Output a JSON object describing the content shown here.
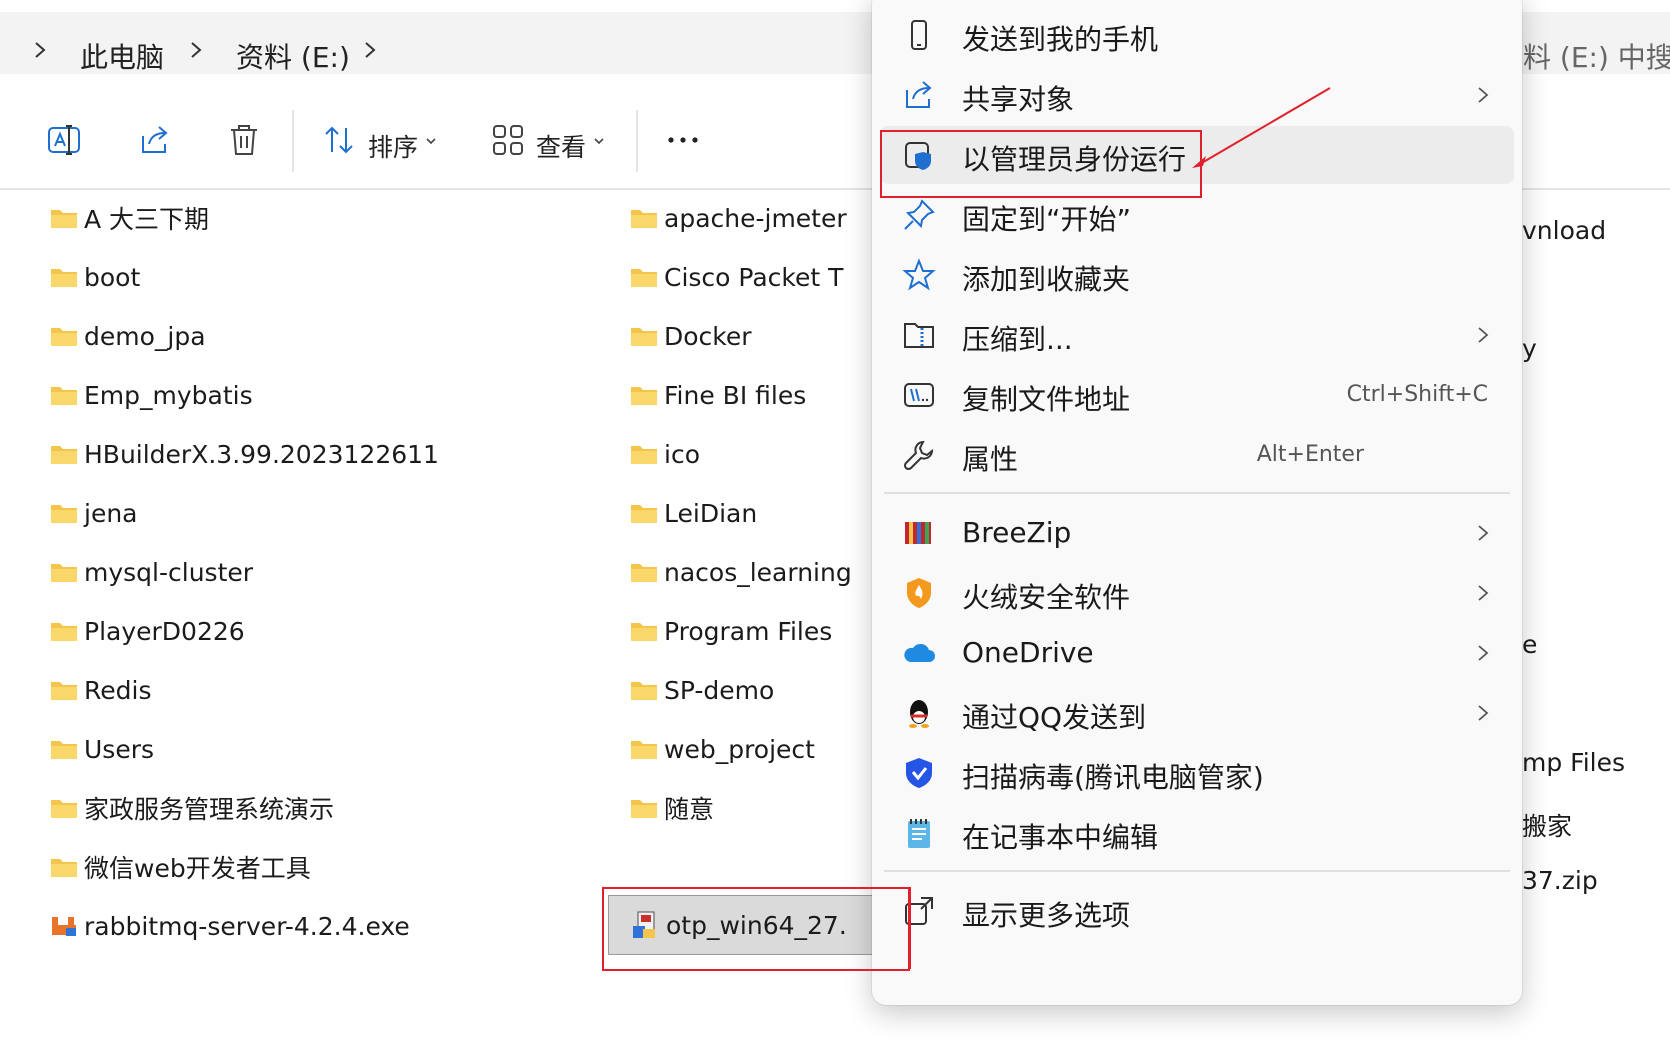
{
  "breadcrumb": {
    "items": [
      "此电脑",
      "资料 (E:)"
    ]
  },
  "search": {
    "ghost_text": "资料 (E:) 中搜"
  },
  "toolbar": {
    "sort_label": "排序",
    "view_label": "查看"
  },
  "files": {
    "col1": [
      "A 大三下期",
      "boot",
      "demo_jpa",
      "Emp_mybatis",
      "HBuilderX.3.99.2023122611",
      "jena",
      "mysql-cluster",
      "PlayerD0226",
      "Redis",
      "Users",
      "家政服务管理系统演示",
      "微信web开发者工具",
      "rabbitmq-server-4.2.4.exe"
    ],
    "col2": [
      "apache-jmeter",
      "Cisco Packet T",
      "Docker",
      "Fine BI files",
      "ico",
      "LeiDian",
      "nacos_learning",
      "Program Files",
      "SP-demo",
      "web_project",
      "随意",
      "otp_win64_27."
    ],
    "col3_partial": [
      "vnload",
      "y",
      "e",
      "mp Files",
      "搬家",
      "37.zip"
    ]
  },
  "menu": {
    "items": [
      {
        "label": "发送到我的手机",
        "icon": "phone-icon"
      },
      {
        "label": "共享对象",
        "icon": "share-icon",
        "submenu": true
      },
      {
        "label": "以管理员身份运行",
        "icon": "shield-icon"
      },
      {
        "label": "固定到“开始”",
        "icon": "pin-icon"
      },
      {
        "label": "添加到收藏夹",
        "icon": "star-icon"
      },
      {
        "label": "压缩到...",
        "icon": "zip-folder-icon",
        "submenu": true
      },
      {
        "label": "复制文件地址",
        "icon": "copy-path-icon",
        "shortcut": "Ctrl+Shift+C"
      },
      {
        "label": "属性",
        "icon": "wrench-icon",
        "shortcut": "Alt+Enter"
      },
      {
        "label": "BreeZip",
        "icon": "breezip-icon",
        "submenu": true
      },
      {
        "label": "火绒安全软件",
        "icon": "huorong-icon",
        "submenu": true
      },
      {
        "label": "OneDrive",
        "icon": "onedrive-icon",
        "submenu": true
      },
      {
        "label": "通过QQ发送到",
        "icon": "qq-icon",
        "submenu": true
      },
      {
        "label": "扫描病毒(腾讯电脑管家)",
        "icon": "tencent-shield-icon"
      },
      {
        "label": "在记事本中编辑",
        "icon": "notepad-icon"
      },
      {
        "label": "显示更多选项",
        "icon": "more-options-icon"
      }
    ]
  },
  "colors": {
    "folder": "#f3c64b",
    "annotation_red": "#e0202a",
    "accent_blue": "#1f6fd1"
  }
}
